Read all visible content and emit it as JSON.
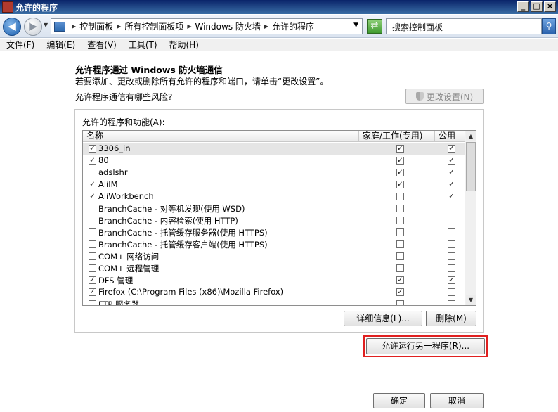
{
  "window": {
    "title": "允许的程序"
  },
  "address": {
    "breadcrumbs": [
      "控制面板",
      "所有控制面板项",
      "Windows 防火墙",
      "允许的程序"
    ],
    "search_placeholder": "搜索控制面板"
  },
  "menu": [
    "文件(F)",
    "编辑(E)",
    "查看(V)",
    "工具(T)",
    "帮助(H)"
  ],
  "content": {
    "heading": "允许程序通过 Windows 防火墙通信",
    "description": "若要添加、更改或删除所有允许的程序和端口，请单击“更改设置”。",
    "risk_link": "允许程序通信有哪些风险?",
    "change_settings": "更改设置(N)",
    "group_label": "允许的程序和功能(A):",
    "columns": {
      "name": "名称",
      "home": "家庭/工作(专用)",
      "public": "公用"
    },
    "rows": [
      {
        "name": "3306_in",
        "enabled": true,
        "home": true,
        "public": true
      },
      {
        "name": "80",
        "enabled": true,
        "home": true,
        "public": true
      },
      {
        "name": "adslshr",
        "enabled": false,
        "home": true,
        "public": true
      },
      {
        "name": "AliIM",
        "enabled": true,
        "home": true,
        "public": true
      },
      {
        "name": "AliWorkbench",
        "enabled": true,
        "home": false,
        "public": true
      },
      {
        "name": "BranchCache - 对等机发现(使用 WSD)",
        "enabled": false,
        "home": false,
        "public": false
      },
      {
        "name": "BranchCache - 内容检索(使用 HTTP)",
        "enabled": false,
        "home": false,
        "public": false
      },
      {
        "name": "BranchCache - 托管缓存服务器(使用 HTTPS)",
        "enabled": false,
        "home": false,
        "public": false
      },
      {
        "name": "BranchCache - 托管缓存客户端(使用 HTTPS)",
        "enabled": false,
        "home": false,
        "public": false
      },
      {
        "name": "COM+ 网络访问",
        "enabled": false,
        "home": false,
        "public": false
      },
      {
        "name": "COM+ 远程管理",
        "enabled": false,
        "home": false,
        "public": false
      },
      {
        "name": "DFS 管理",
        "enabled": true,
        "home": true,
        "public": true
      },
      {
        "name": "Firefox (C:\\Program Files (x86)\\Mozilla Firefox)",
        "enabled": true,
        "home": true,
        "public": false
      },
      {
        "name": "FTP 服务器",
        "enabled": false,
        "home": false,
        "public": false
      }
    ],
    "details_button": "详细信息(L)...",
    "delete_button": "删除(M)",
    "allow_other_button": "允许运行另一程序(R)...",
    "ok_button": "确定",
    "cancel_button": "取消"
  }
}
